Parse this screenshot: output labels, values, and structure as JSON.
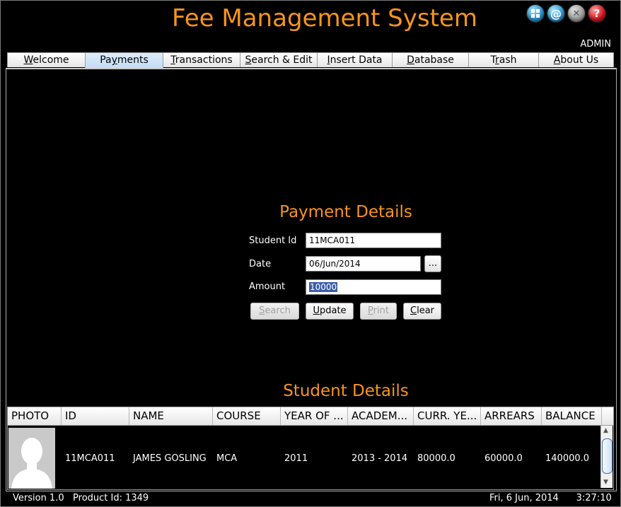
{
  "app": {
    "title": "Fee Management System",
    "user": "ADMIN"
  },
  "top_icons": [
    {
      "name": "dashboard-grid-icon",
      "color": "#2a8fc7"
    },
    {
      "name": "email-at-icon",
      "color": "#2c92cc"
    },
    {
      "name": "close-icon",
      "color": "#9a9a9a"
    },
    {
      "name": "help-icon",
      "color": "#d3161c"
    }
  ],
  "tabs": {
    "welcome": {
      "pre": "",
      "ul": "W",
      "post": "elcome"
    },
    "payments": {
      "pre": "Pa",
      "ul": "y",
      "post": "ments"
    },
    "transactions": {
      "pre": "",
      "ul": "T",
      "post": "ransactions"
    },
    "search_edit": {
      "pre": "",
      "ul": "S",
      "post": "earch & Edit"
    },
    "insert_data": {
      "pre": "",
      "ul": "I",
      "post": "nsert Data"
    },
    "database": {
      "pre": "",
      "ul": "D",
      "post": "atabase"
    },
    "trash": {
      "pre": "T",
      "ul": "r",
      "post": "ash"
    },
    "about_us": {
      "pre": "",
      "ul": "A",
      "post": "bout Us"
    },
    "active": "Payments"
  },
  "payment_details": {
    "title": "Payment Details",
    "student_id_label": "Student Id",
    "student_id_value": "11MCA011",
    "date_label": "Date",
    "date_value": "06/Jun/2014",
    "date_picker_label": "...",
    "amount_label": "Amount",
    "amount_value": "10000"
  },
  "buttons": {
    "search": {
      "pre": "",
      "ul": "S",
      "post": "earch",
      "enabled": false
    },
    "update": {
      "pre": "",
      "ul": "U",
      "post": "pdate",
      "enabled": true
    },
    "print": {
      "pre": "",
      "ul": "P",
      "post": "rint",
      "enabled": false
    },
    "clear": {
      "pre": "",
      "ul": "C",
      "post": "lear",
      "enabled": true
    }
  },
  "student_details": {
    "title": "Student Details",
    "columns": [
      "PHOTO",
      "ID",
      "NAME",
      "COURSE",
      "YEAR OF ...",
      "ACADEM...",
      "CURR. YE...",
      "ARREARS",
      "BALANCE"
    ],
    "rows": [
      {
        "photo": "student-photo-placeholder",
        "id": "11MCA011",
        "name": "JAMES GOSLING",
        "course": "MCA",
        "year_of_join": "2011",
        "academic_year": "2013 - 2014",
        "curr_year_fee": "80000.0",
        "arrears": "60000.0",
        "balance": "140000.0"
      }
    ]
  },
  "status": {
    "version": "Version 1.0",
    "product_id": "Product Id: 1349",
    "date": "Fri, 6 Jun, 2014",
    "time": "3:27:10"
  },
  "colors": {
    "accent": "#f7941d",
    "background": "#000000",
    "active_tab": "#c3dcf5"
  }
}
